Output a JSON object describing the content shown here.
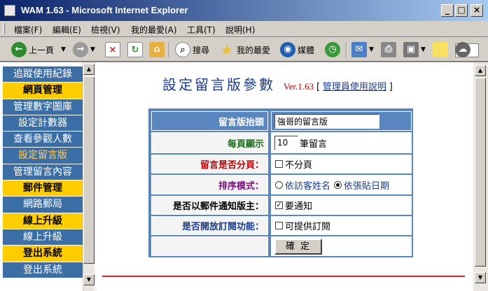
{
  "window": {
    "title": "WAM 1.63 - Microsoft Internet Explorer",
    "minimize": "_",
    "maximize": "□",
    "close": "×"
  },
  "menu": [
    "檔案(F)",
    "編輯(E)",
    "檢視(V)",
    "我的最愛(A)",
    "工具(T)",
    "說明(H)"
  ],
  "toolbar": {
    "back": "上一頁",
    "search": "搜尋",
    "favorites": "我的最愛",
    "media": "媒體"
  },
  "nav": [
    {
      "label": "追蹤使用紀錄",
      "kind": "link"
    },
    {
      "label": "網頁管理",
      "kind": "section"
    },
    {
      "label": "管理數字圖庫",
      "kind": "link"
    },
    {
      "label": "設定計數器",
      "kind": "link"
    },
    {
      "label": "查看參觀人數",
      "kind": "link"
    },
    {
      "label": "設定留言版",
      "kind": "active"
    },
    {
      "label": "管理留言內容",
      "kind": "link"
    },
    {
      "label": "郵件管理",
      "kind": "section"
    },
    {
      "label": "網路郵局",
      "kind": "link"
    },
    {
      "label": "線上升級",
      "kind": "section"
    },
    {
      "label": "線上升級",
      "kind": "link"
    },
    {
      "label": "登出系統",
      "kind": "section"
    },
    {
      "label": "登出系統",
      "kind": "link"
    }
  ],
  "page": {
    "title": "設定留言版參數",
    "version": "Ver.1.63",
    "bracket_open": "[",
    "help_link": "管理員使用說明",
    "bracket_close": "]"
  },
  "form": {
    "board_title_label": "留言版抬頭",
    "board_title_value": "強哥的留言版",
    "per_page_label": "每頁顯示",
    "per_page_value": "10",
    "per_page_unit": "筆留言",
    "paging_label": "留言是否分頁：",
    "paging_option": "不分頁",
    "paging_checked": false,
    "sort_label": "排序模式：",
    "sort_option_a": "依訪客姓名",
    "sort_option_b": "依張貼日期",
    "sort_selected": "依張貼日期",
    "notify_label": "是否以郵件通知版主：",
    "notify_option": "要通知",
    "notify_checked": true,
    "subscribe_label": "是否開放訂閱功能：",
    "subscribe_option": "可提供訂閱",
    "subscribe_checked": false,
    "submit_label": "確定"
  },
  "colors": {
    "nav_blue": "#3a6ea5",
    "section_yellow": "#ffcc00",
    "form_frame": "#5a86c0",
    "title_blue": "#1a3b8c",
    "version_red": "#b00000",
    "rule_red": "#cc2222"
  }
}
